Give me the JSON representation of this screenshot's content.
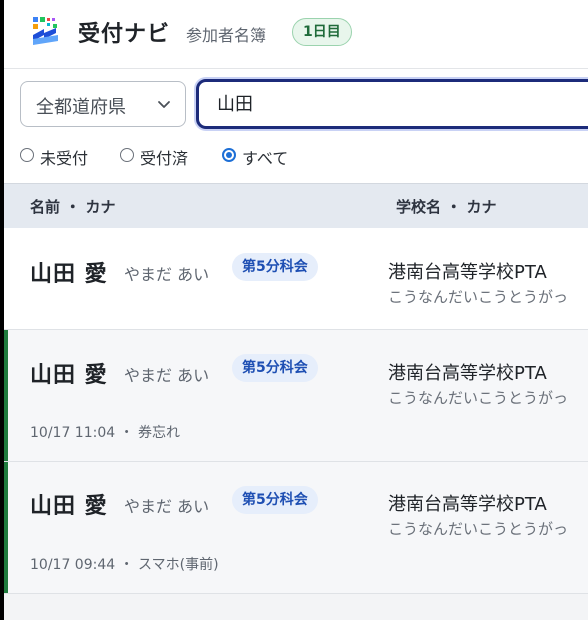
{
  "header": {
    "title": "受付ナビ",
    "subtitle": "参加者名簿",
    "day_badge": "1日目"
  },
  "filters": {
    "prefecture_value": "全都道府県",
    "search_value": "山田",
    "radios": [
      {
        "label": "未受付",
        "checked": false
      },
      {
        "label": "受付済",
        "checked": false
      },
      {
        "label": "すべて",
        "checked": true
      }
    ]
  },
  "table": {
    "columns": [
      "名前 ・ カナ",
      "学校名 ・ カナ"
    ],
    "rows": [
      {
        "name": "山田 愛",
        "kana": "やまだ あい",
        "session": "第5分科会",
        "school": "港南台高等学校PTA",
        "school_kana": "こうなんだいこうとうがっ",
        "meta": ""
      },
      {
        "name": "山田 愛",
        "kana": "やまだ あい",
        "session": "第5分科会",
        "school": "港南台高等学校PTA",
        "school_kana": "こうなんだいこうとうがっ",
        "meta": "10/17 11:04 ・ 券忘れ"
      },
      {
        "name": "山田 愛",
        "kana": "やまだ あい",
        "session": "第5分科会",
        "school": "港南台高等学校PTA",
        "school_kana": "こうなんだいこうとうがっ",
        "meta": "10/17 09:44 ・ スマホ(事前)"
      }
    ]
  },
  "colors": {
    "accent_received": "#1e7a3d",
    "session_badge_bg": "#e6eefb",
    "search_border": "#1c2b7a",
    "radio_selected": "#1d6fd6"
  }
}
